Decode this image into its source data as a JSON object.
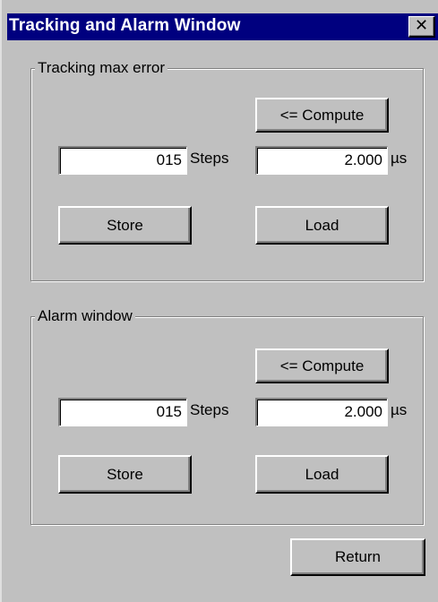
{
  "window": {
    "title": "Tracking and Alarm Window",
    "close_glyph": "✕"
  },
  "tracking": {
    "legend": "Tracking max error",
    "compute_label": "<= Compute",
    "steps_value": "015",
    "steps_unit": "Steps",
    "time_value": "2.000",
    "time_unit": "µs",
    "store_label": "Store",
    "load_label": "Load"
  },
  "alarm": {
    "legend": "Alarm window",
    "compute_label": "<= Compute",
    "steps_value": "015",
    "steps_unit": "Steps",
    "time_value": "2.000",
    "time_unit": "µs",
    "store_label": "Store",
    "load_label": "Load"
  },
  "footer": {
    "return_label": "Return"
  },
  "colors": {
    "face": "#c0c0c0",
    "titlebar": "#00007f",
    "title_text": "#ffffff"
  },
  "icons": {
    "close": "close-icon"
  }
}
